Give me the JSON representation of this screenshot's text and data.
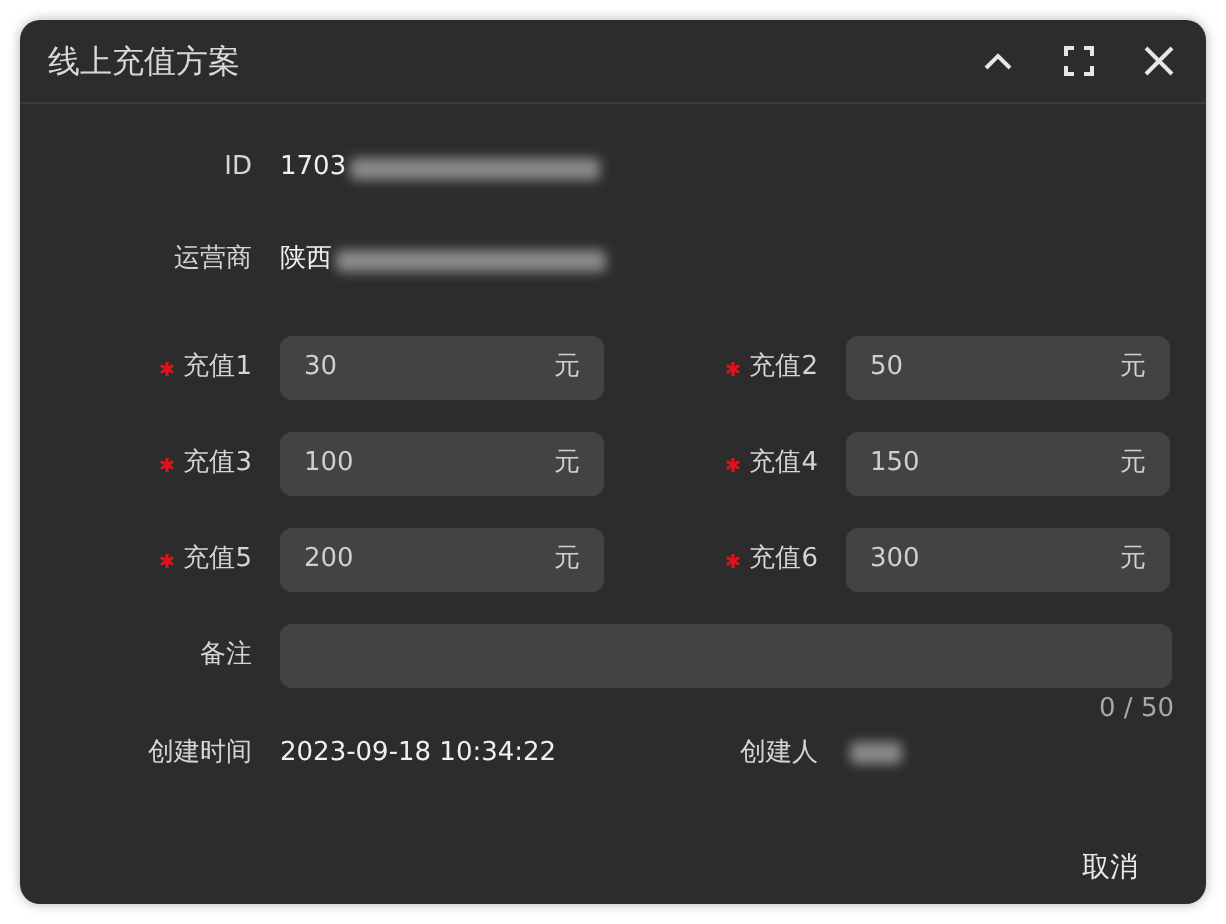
{
  "window": {
    "title": "线上充值方案"
  },
  "info": [
    {
      "label": "ID",
      "value": "1703",
      "redacted": true
    },
    {
      "label": "运营商",
      "value": "陕西",
      "redacted": true
    }
  ],
  "amounts": [
    {
      "label": "充值1",
      "required": true,
      "value": "30",
      "unit": "元"
    },
    {
      "label": "充值2",
      "required": true,
      "value": "50",
      "unit": "元"
    },
    {
      "label": "充值3",
      "required": true,
      "value": "100",
      "unit": "元"
    },
    {
      "label": "充值4",
      "required": true,
      "value": "150",
      "unit": "元"
    },
    {
      "label": "充值5",
      "required": true,
      "value": "200",
      "unit": "元"
    },
    {
      "label": "充值6",
      "required": true,
      "value": "300",
      "unit": "元"
    }
  ],
  "note": {
    "label": "备注",
    "counter": "0 / 50"
  },
  "created_time": {
    "label": "创建时间",
    "value": "2023-09-18 10:34:22"
  },
  "creator": {
    "label": "创建人",
    "redacted": true
  },
  "buttons": [
    "取消"
  ]
}
